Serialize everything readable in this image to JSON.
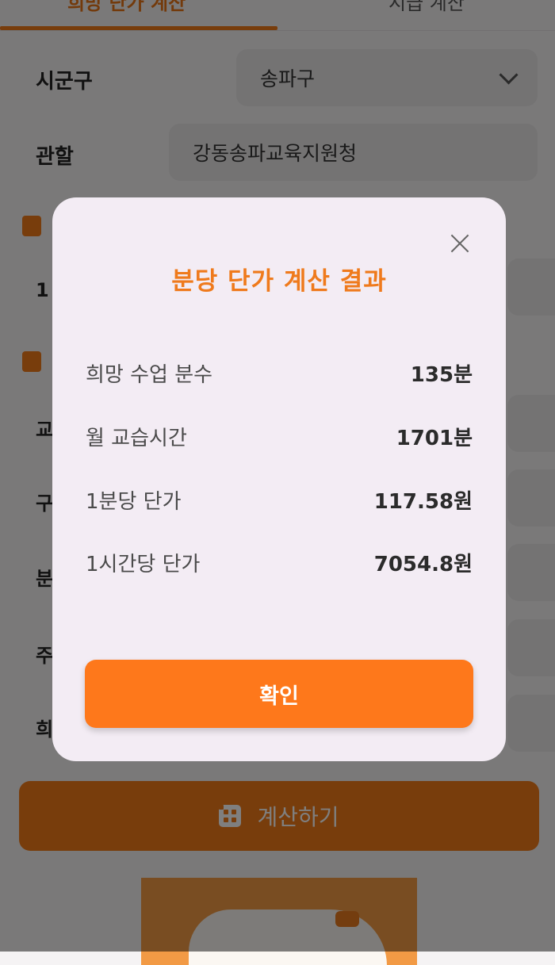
{
  "tabs": {
    "active_label": "희망 단가 계산",
    "inactive_label": "시급 계산"
  },
  "form": {
    "district_label": "시군구",
    "district_value": "송파구",
    "jurisdiction_label": "관할",
    "jurisdiction_value": "강동송파교육지원청",
    "partial_labels": [
      "1",
      "교",
      "구",
      "분",
      "주",
      "희"
    ]
  },
  "calc_button_label": "계산하기",
  "dialog": {
    "title": "분당 단가 계산 결과",
    "rows": [
      {
        "label": "희망 수업 분수",
        "value": "135분"
      },
      {
        "label": "월 교습시간",
        "value": "1701분"
      },
      {
        "label": "1분당 단가",
        "value": "117.58원"
      },
      {
        "label": "1시간당 단가",
        "value": "7054.8원"
      }
    ],
    "confirm_label": "확인"
  },
  "colors": {
    "accent": "#fe781b",
    "dialog_bg": "#f3ecf4"
  }
}
